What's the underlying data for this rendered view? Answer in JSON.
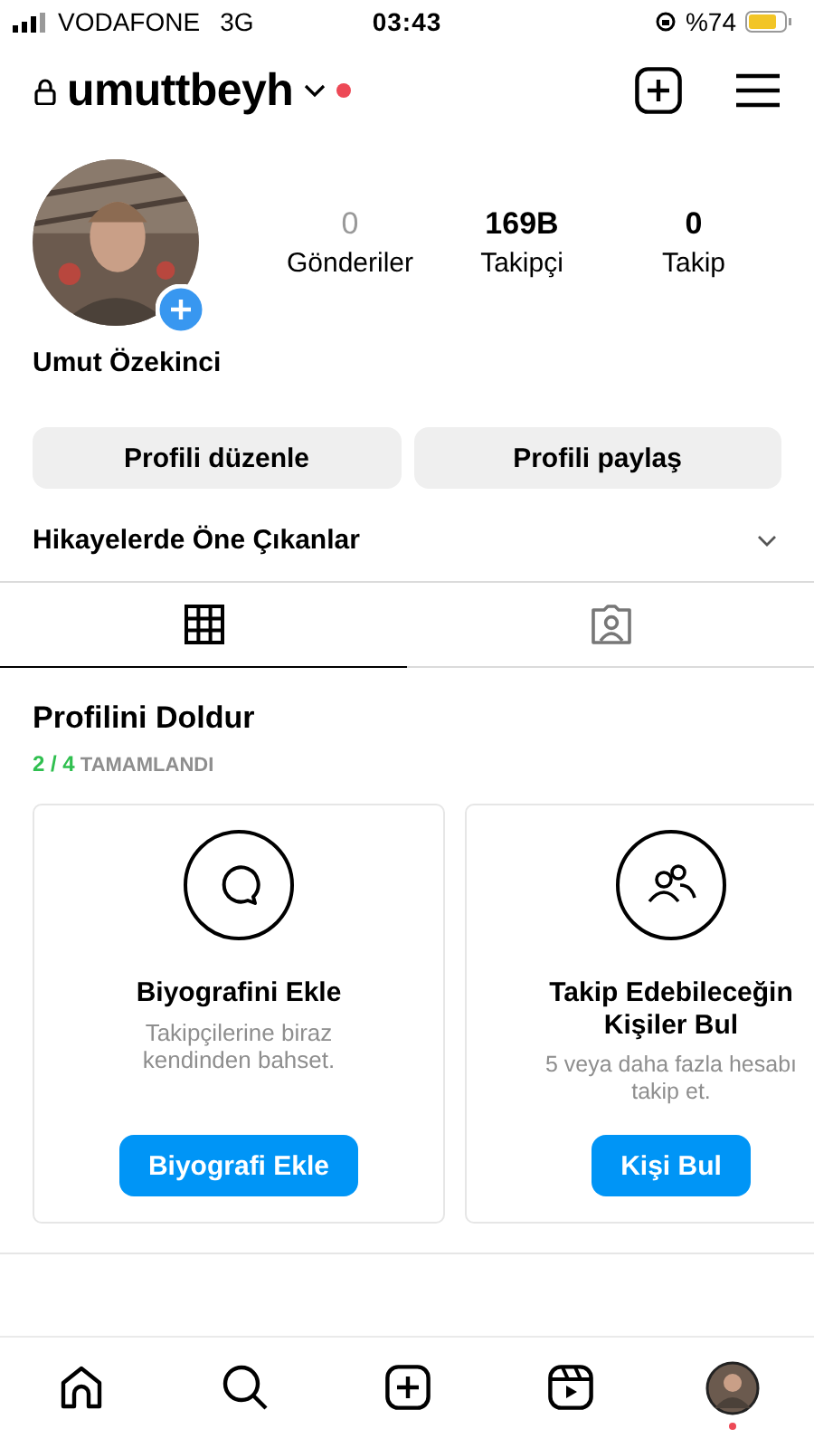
{
  "status_bar": {
    "carrier": "VODAFONE",
    "network": "3G",
    "time": "03:43",
    "battery": "%74"
  },
  "header": {
    "username": "umuttbeyh",
    "locked": true,
    "notification_dot": true
  },
  "profile": {
    "name": "Umut Özekinci",
    "stats": [
      {
        "value": "0",
        "label": "Gönderiler",
        "dimmed": true
      },
      {
        "value": "169B",
        "label": "Takipçi",
        "dimmed": false
      },
      {
        "value": "0",
        "label": "Takip",
        "dimmed": false
      }
    ]
  },
  "buttons": [
    "Profili düzenle",
    "Profili paylaş"
  ],
  "highlights": {
    "title": "Hikayelerde Öne Çıkanlar",
    "expanded": false
  },
  "tabs": [
    {
      "kind": "grid",
      "selected": true
    },
    {
      "kind": "tagged",
      "selected": false
    }
  ],
  "completion": {
    "title": "Profilini Doldur",
    "done": "2 / 4",
    "label": "TAMAMLANDI",
    "cards": [
      {
        "kind": "bio",
        "title": "Biyografini Ekle",
        "text": "Takipçilerine biraz kendinden bahset.",
        "button": "Biyografi Ekle"
      },
      {
        "kind": "people",
        "title": "Takip Edebileceğin Kişiler Bul",
        "text": "5 veya daha fazla hesabı takip et.",
        "button": "Kişi Bul"
      }
    ]
  },
  "bottom_nav": [
    {
      "kind": "home"
    },
    {
      "kind": "search"
    },
    {
      "kind": "create"
    },
    {
      "kind": "reels"
    },
    {
      "kind": "profile",
      "notification_dot": true
    }
  ]
}
